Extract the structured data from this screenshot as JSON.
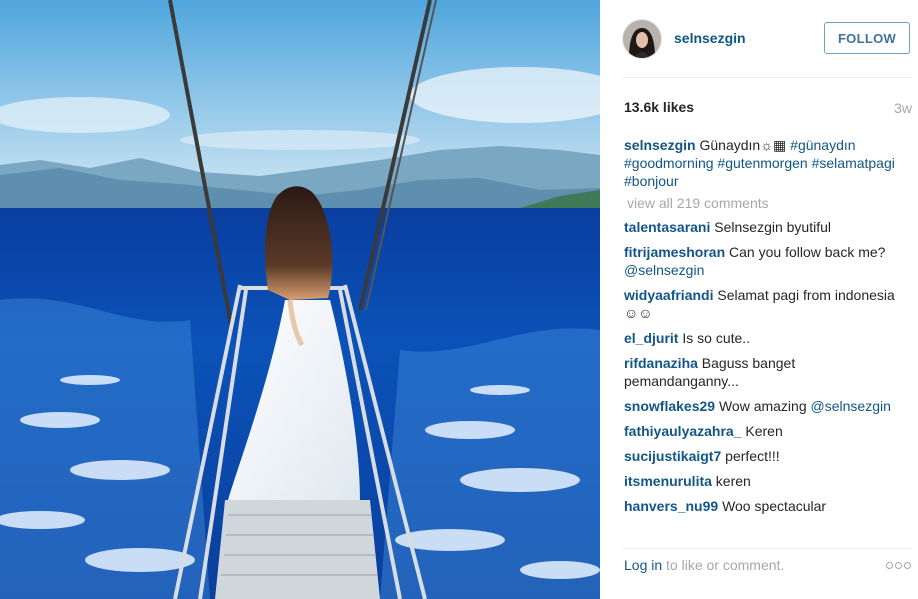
{
  "post": {
    "username": "selnsezgin",
    "follow_label": "FOLLOW",
    "likes": "13.6k likes",
    "time": "3w",
    "caption": {
      "user": "selnsezgin",
      "text": "Günaydın☼▦",
      "hashtags": [
        "#günaydın",
        "#goodmorning",
        "#gutenmorgen",
        "#selamatpagi",
        "#bonjour"
      ]
    },
    "view_all": "view all 219 comments",
    "comments": [
      {
        "user": "talentasarani",
        "text": "Selnsezgin byutiful"
      },
      {
        "user": "fitrijameshoran",
        "text": "Can you follow back me?",
        "mention": "@selnsezgin"
      },
      {
        "user": "widyaafriandi",
        "text": "Selamat pagi from indonesia☺☺"
      },
      {
        "user": "el_djurit",
        "text": "Is so cute.."
      },
      {
        "user": "rifdanaziha",
        "text": "Baguss banget pemandanganny..."
      },
      {
        "user": "snowflakes29",
        "text": "Wow amazing",
        "mention": "@selnsezgin"
      },
      {
        "user": "fathiyaulyazahra_",
        "text": "Keren"
      },
      {
        "user": "sucijustikaigt7",
        "text": "perfect!!!"
      },
      {
        "user": "itsmenurulita",
        "text": "keren"
      },
      {
        "user": "hanvers_nu99",
        "text": "Woo spectacular"
      }
    ],
    "footer": {
      "login_link": "Log in",
      "login_rest": " to like or comment."
    }
  },
  "icons": {
    "more": "more-options-icon"
  },
  "colors": {
    "link": "#125688",
    "muted": "#a5a7aa",
    "follow": "#3f729b"
  }
}
